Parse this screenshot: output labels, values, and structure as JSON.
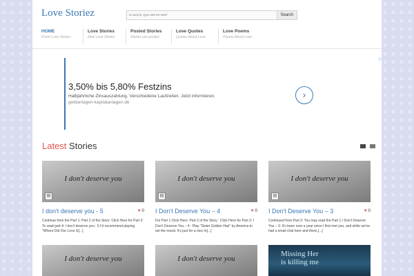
{
  "site": {
    "title": "Love Storiez"
  },
  "search": {
    "placeholder": "to search, type and hit enter",
    "button_label": "Search"
  },
  "nav": [
    {
      "label": "HOME",
      "sub": "Fresh Love Stories"
    },
    {
      "label": "Love Stories",
      "sub": "Real Love Stories"
    },
    {
      "label": "Posted Stories",
      "sub": "Stories you posted"
    },
    {
      "label": "Love Quotes",
      "sub": "Quotes About Love"
    },
    {
      "label": "Love Poems",
      "sub": "Poems About Love"
    }
  ],
  "ad": {
    "headline": "3,50% bis 5,80% Festzins",
    "description": "Halbjährliche Zinsauszahlung. Verschiedene Laufzeiten. Jetzt informieren.",
    "url": "geldanlagen-kapitalanlagen.de",
    "arrow": "›",
    "choices_icon": "ad-choices-icon"
  },
  "section": {
    "accent": "Latest",
    "rest": " Stories"
  },
  "cards": [
    {
      "image_text": "I don't deserve you",
      "title": "I don't deserve you - 5",
      "likes": "0",
      "excerpt": "Continue from the Part 1: Part 2 of the Story: Click Here for Part 3: To read part 4: I don't deserve you : 5 I'd recommend playing \"Where Did Our Love G[...]"
    },
    {
      "image_text": "I don't deserve you",
      "title": "I Don't Deserve You – 4",
      "likes": "0",
      "excerpt": "For Part 1 Click Here: Part 2 of the Story : Click Here for Part 3: I Don't Deserve You – 4 : Play \"Sister Golden Hair\" by America to set the mood. It's just for a nice m[...]"
    },
    {
      "image_text": "I don't deserve you",
      "title": "I Don't Deserve You – 3",
      "likes": "0",
      "excerpt": "Continued from Part 2: You may read the Part 1 I Don't Deserve You – 3: It's been over a year since I first met you, and while we've had a small chat here and there,[...]"
    }
  ],
  "row2": {
    "image_text": "I don't deserve you",
    "third_line1": "Missing Her",
    "third_line2": "is killing me"
  },
  "colors": {
    "accent": "#3b78b4",
    "highlight": "#e0524f"
  }
}
